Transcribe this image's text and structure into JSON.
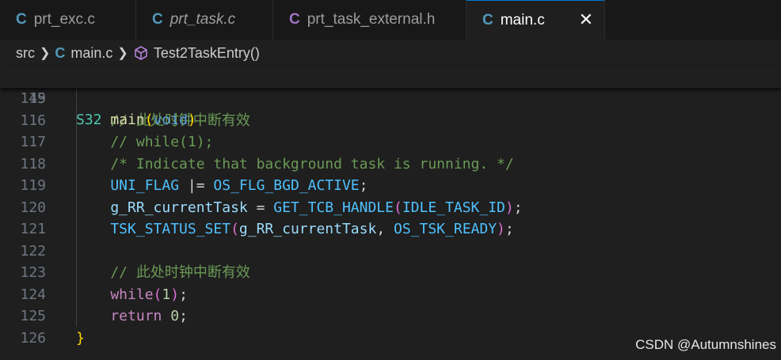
{
  "tabs": [
    {
      "label": "prt_exc.c",
      "icon": "C",
      "icon_color": "#519aba",
      "italic": false,
      "active": false
    },
    {
      "label": "prt_task.c",
      "icon": "C",
      "icon_color": "#519aba",
      "italic": true,
      "active": false
    },
    {
      "label": "prt_task_external.h",
      "icon": "C",
      "icon_color": "#a074c4",
      "italic": false,
      "active": false
    },
    {
      "label": "main.c",
      "icon": "C",
      "icon_color": "#519aba",
      "italic": false,
      "active": true
    }
  ],
  "breadcrumb": {
    "folder": "src",
    "file_icon": "C",
    "file": "main.c",
    "symbol": "Test2TaskEntry()"
  },
  "sticky_line": {
    "number": "49",
    "tokens": [
      [
        "S32",
        "#4ec9b0"
      ],
      [
        " ",
        null
      ],
      [
        "main",
        "#dcdcaa"
      ],
      [
        "(",
        "#ffd700"
      ],
      [
        "void",
        "#569cd6"
      ],
      [
        ")",
        "#ffd700"
      ]
    ]
  },
  "lines": [
    {
      "number": "115",
      "tokens": []
    },
    {
      "number": "116",
      "tokens": [
        [
          "    // 此处时钟中断有效",
          "#6a9955"
        ]
      ]
    },
    {
      "number": "117",
      "tokens": [
        [
          "    // while(1);",
          "#6a9955"
        ]
      ]
    },
    {
      "number": "118",
      "tokens": [
        [
          "    /* Indicate that background task is running. */",
          "#6a9955"
        ]
      ]
    },
    {
      "number": "119",
      "tokens": [
        [
          "    UNI_FLAG",
          "#4fc1ff"
        ],
        [
          " |= ",
          "#d4d4d4"
        ],
        [
          "OS_FLG_BGD_ACTIVE",
          "#4fc1ff"
        ],
        [
          ";",
          "#d4d4d4"
        ]
      ]
    },
    {
      "number": "120",
      "tokens": [
        [
          "    g_RR_currentTask",
          "#9cdcfe"
        ],
        [
          " = ",
          "#d4d4d4"
        ],
        [
          "GET_TCB_HANDLE",
          "#4fc1ff"
        ],
        [
          "(",
          "#da70d6"
        ],
        [
          "IDLE_TASK_ID",
          "#4fc1ff"
        ],
        [
          ")",
          "#da70d6"
        ],
        [
          ";",
          "#d4d4d4"
        ]
      ]
    },
    {
      "number": "121",
      "tokens": [
        [
          "    TSK_STATUS_SET",
          "#4fc1ff"
        ],
        [
          "(",
          "#da70d6"
        ],
        [
          "g_RR_currentTask",
          "#9cdcfe"
        ],
        [
          ", ",
          "#d4d4d4"
        ],
        [
          "OS_TSK_READY",
          "#4fc1ff"
        ],
        [
          ")",
          "#da70d6"
        ],
        [
          ";",
          "#d4d4d4"
        ]
      ]
    },
    {
      "number": "122",
      "tokens": []
    },
    {
      "number": "123",
      "tokens": [
        [
          "    // 此处时钟中断有效",
          "#6a9955"
        ]
      ]
    },
    {
      "number": "124",
      "tokens": [
        [
          "    while",
          "#c586c0"
        ],
        [
          "(",
          "#da70d6"
        ],
        [
          "1",
          "#b5cea8"
        ],
        [
          ")",
          "#da70d6"
        ],
        [
          ";",
          "#d4d4d4"
        ]
      ]
    },
    {
      "number": "125",
      "tokens": [
        [
          "    return",
          "#c586c0"
        ],
        [
          " ",
          null
        ],
        [
          "0",
          "#b5cea8"
        ],
        [
          ";",
          "#d4d4d4"
        ]
      ]
    },
    {
      "number": "126",
      "tokens": [
        [
          "}",
          "#ffd700"
        ]
      ]
    }
  ],
  "watermark": "CSDN @Autumnshines"
}
